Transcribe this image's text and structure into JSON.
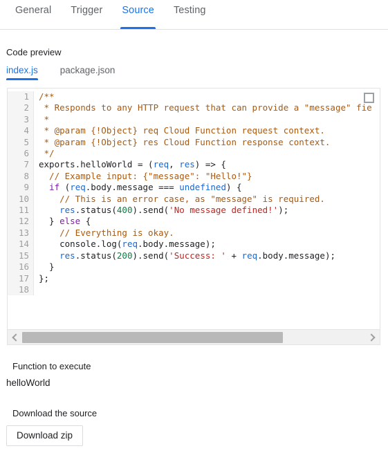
{
  "tabs": [
    {
      "label": "General",
      "active": false
    },
    {
      "label": "Trigger",
      "active": false
    },
    {
      "label": "Source",
      "active": true
    },
    {
      "label": "Testing",
      "active": false
    }
  ],
  "code_preview": {
    "heading": "Code preview",
    "file_tabs": [
      {
        "label": "index.js",
        "active": true
      },
      {
        "label": "package.json",
        "active": false
      }
    ],
    "expand_icon": "fullscreen-expand-icon",
    "line_numbers": [
      "1",
      "2",
      "3",
      "4",
      "5",
      "6",
      "7",
      "8",
      "9",
      "10",
      "11",
      "12",
      "13",
      "14",
      "15",
      "16",
      "17",
      "18"
    ],
    "lines": [
      {
        "n": "1",
        "tokens": [
          {
            "t": "/**",
            "c": "com"
          }
        ]
      },
      {
        "n": "2",
        "tokens": [
          {
            "t": " * Responds to any HTTP request that can provide a \"message\" fie",
            "c": "com"
          }
        ]
      },
      {
        "n": "3",
        "tokens": [
          {
            "t": " *",
            "c": "com"
          }
        ]
      },
      {
        "n": "4",
        "tokens": [
          {
            "t": " * @param {!Object} req Cloud Function request context.",
            "c": "com"
          }
        ]
      },
      {
        "n": "5",
        "tokens": [
          {
            "t": " * @param {!Object} res Cloud Function response context.",
            "c": "com"
          }
        ]
      },
      {
        "n": "6",
        "tokens": [
          {
            "t": " */",
            "c": "com"
          }
        ]
      },
      {
        "n": "7",
        "tokens": [
          {
            "t": "exports.helloWorld = (",
            "c": "pln"
          },
          {
            "t": "req",
            "c": "var"
          },
          {
            "t": ", ",
            "c": "pln"
          },
          {
            "t": "res",
            "c": "var"
          },
          {
            "t": ") => {",
            "c": "pln"
          }
        ]
      },
      {
        "n": "8",
        "tokens": [
          {
            "t": "  // Example input: {\"message\": \"Hello!\"}",
            "c": "com"
          }
        ]
      },
      {
        "n": "9",
        "tokens": [
          {
            "t": "  ",
            "c": "pln"
          },
          {
            "t": "if",
            "c": "key"
          },
          {
            "t": " (",
            "c": "pln"
          },
          {
            "t": "req",
            "c": "var"
          },
          {
            "t": ".body.message === ",
            "c": "pln"
          },
          {
            "t": "undefined",
            "c": "var"
          },
          {
            "t": ") {",
            "c": "pln"
          }
        ]
      },
      {
        "n": "10",
        "tokens": [
          {
            "t": "    // This is an error case, as \"message\" is required.",
            "c": "com"
          }
        ]
      },
      {
        "n": "11",
        "tokens": [
          {
            "t": "    ",
            "c": "pln"
          },
          {
            "t": "res",
            "c": "var"
          },
          {
            "t": ".status(",
            "c": "pln"
          },
          {
            "t": "400",
            "c": "num"
          },
          {
            "t": ").send(",
            "c": "pln"
          },
          {
            "t": "'No message defined!'",
            "c": "str"
          },
          {
            "t": ");",
            "c": "pln"
          }
        ]
      },
      {
        "n": "12",
        "tokens": [
          {
            "t": "  } ",
            "c": "pln"
          },
          {
            "t": "else",
            "c": "key"
          },
          {
            "t": " {",
            "c": "pln"
          }
        ]
      },
      {
        "n": "13",
        "tokens": [
          {
            "t": "    // Everything is okay.",
            "c": "com"
          }
        ]
      },
      {
        "n": "14",
        "tokens": [
          {
            "t": "    console.log(",
            "c": "pln"
          },
          {
            "t": "req",
            "c": "var"
          },
          {
            "t": ".body.message);",
            "c": "pln"
          }
        ]
      },
      {
        "n": "15",
        "tokens": [
          {
            "t": "    ",
            "c": "pln"
          },
          {
            "t": "res",
            "c": "var"
          },
          {
            "t": ".status(",
            "c": "pln"
          },
          {
            "t": "200",
            "c": "num"
          },
          {
            "t": ").send(",
            "c": "pln"
          },
          {
            "t": "'Success: '",
            "c": "str"
          },
          {
            "t": " + ",
            "c": "pln"
          },
          {
            "t": "req",
            "c": "var"
          },
          {
            "t": ".body.message);",
            "c": "pln"
          }
        ]
      },
      {
        "n": "16",
        "tokens": [
          {
            "t": "  }",
            "c": "pln"
          }
        ]
      },
      {
        "n": "17",
        "tokens": [
          {
            "t": "};",
            "c": "pln"
          }
        ]
      },
      {
        "n": "18",
        "tokens": [
          {
            "t": "",
            "c": "pln"
          }
        ]
      }
    ],
    "scrollbar": {
      "left_arrow_icon": "chevron-left-icon",
      "right_arrow_icon": "chevron-right-icon",
      "thumb_width_percent": 76
    }
  },
  "function_to_execute": {
    "label": "Function to execute",
    "value": "helloWorld"
  },
  "download": {
    "label": "Download the source",
    "button_label": "Download zip"
  },
  "colors": {
    "accent": "#1a73e8",
    "text": "#202124",
    "muted": "#5f6368",
    "comment": "#a9590f",
    "string": "#c5221f",
    "keyword": "#7b1fa2",
    "variable": "#1967d2",
    "number": "#0b8043",
    "gutter_bg": "#f5f5f5",
    "scrollbar_thumb": "#b8b8b8"
  }
}
